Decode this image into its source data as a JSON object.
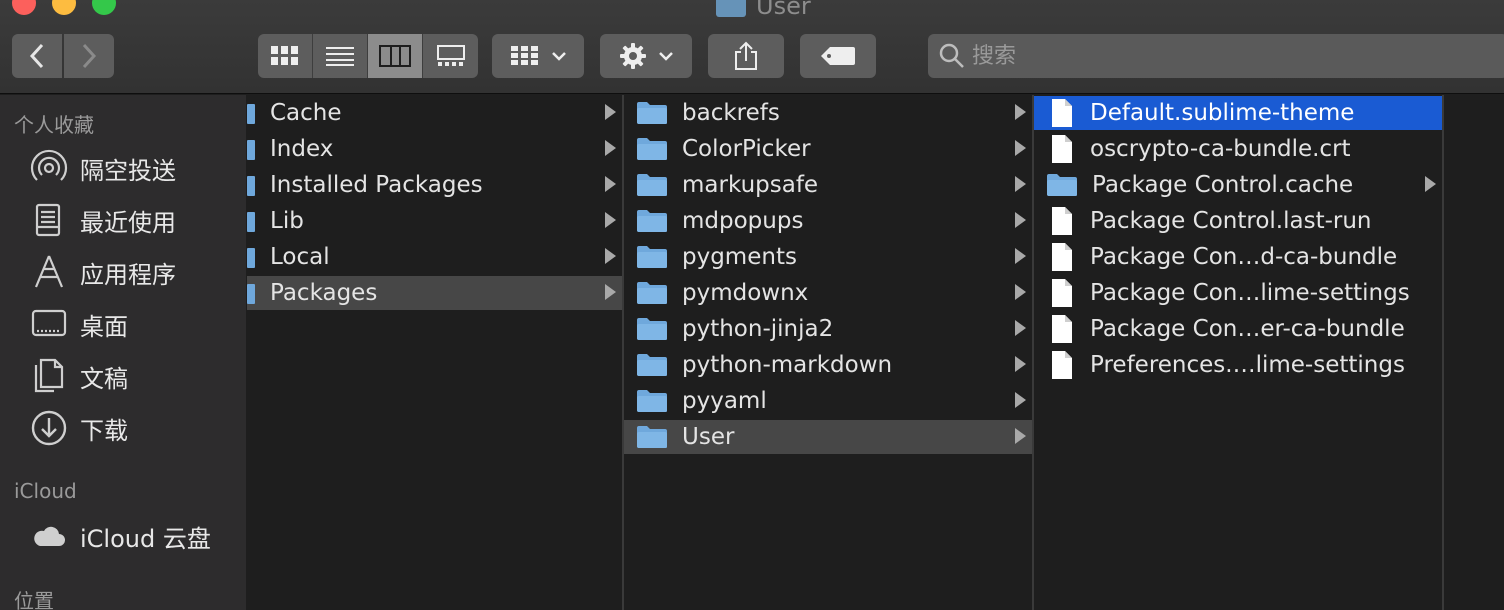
{
  "window": {
    "title": "User"
  },
  "toolbar": {
    "nav": {
      "back_icon": "chevron-left-icon",
      "forward_icon": "chevron-right-icon"
    },
    "view_modes": [
      {
        "name": "icon-view",
        "icon": "grid-icon"
      },
      {
        "name": "list-view",
        "icon": "list-icon"
      },
      {
        "name": "column-view",
        "icon": "columns-icon",
        "active": true
      },
      {
        "name": "gallery-view",
        "icon": "gallery-icon"
      }
    ],
    "search": {
      "placeholder": "搜索"
    }
  },
  "sidebar": {
    "favorites_header": "个人收藏",
    "favorites": [
      {
        "label": "隔空投送",
        "icon": "airdrop-icon"
      },
      {
        "label": "最近使用",
        "icon": "recents-icon"
      },
      {
        "label": "应用程序",
        "icon": "applications-icon"
      },
      {
        "label": "桌面",
        "icon": "desktop-icon"
      },
      {
        "label": "文稿",
        "icon": "documents-icon"
      },
      {
        "label": "下载",
        "icon": "downloads-icon"
      }
    ],
    "icloud_header": "iCloud",
    "icloud": [
      {
        "label": "iCloud 云盘",
        "icon": "cloud-icon"
      }
    ],
    "locations_header": "位置"
  },
  "columns": [
    {
      "items": [
        {
          "label": "Cache"
        },
        {
          "label": "Index"
        },
        {
          "label": "Installed Packages"
        },
        {
          "label": "Lib"
        },
        {
          "label": "Local"
        },
        {
          "label": "Packages",
          "selected": true
        }
      ]
    },
    {
      "items": [
        {
          "label": "backrefs"
        },
        {
          "label": "ColorPicker"
        },
        {
          "label": "markupsafe"
        },
        {
          "label": "mdpopups"
        },
        {
          "label": "pygments"
        },
        {
          "label": "pymdownx"
        },
        {
          "label": "python-jinja2"
        },
        {
          "label": "python-markdown"
        },
        {
          "label": "pyyaml"
        },
        {
          "label": "User",
          "selected": true
        }
      ]
    },
    {
      "items": [
        {
          "label": "Default.sublime-theme",
          "kind": "file"
        },
        {
          "label": "oscrypto-ca-bundle.crt",
          "kind": "file"
        },
        {
          "label": "Package Control.cache",
          "kind": "folder"
        },
        {
          "label": "Package Control.last-run",
          "kind": "file"
        },
        {
          "label": "Package Con…d-ca-bundle",
          "kind": "file"
        },
        {
          "label": "Package Con…lime-settings",
          "kind": "file"
        },
        {
          "label": "Package Con…er-ca-bundle",
          "kind": "file"
        },
        {
          "label": "Preferences.…lime-settings",
          "kind": "file"
        }
      ]
    }
  ],
  "colors": {
    "selection_blue": "#1a5bd3",
    "folder_blue": "#6fa8dc"
  }
}
